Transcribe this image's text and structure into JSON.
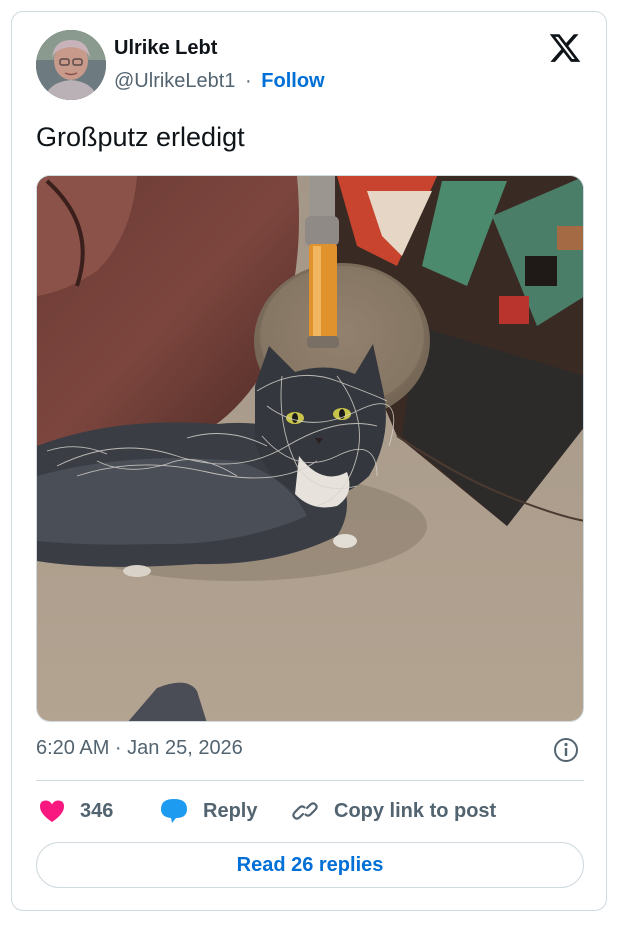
{
  "author": {
    "name": "Ulrike Lebt",
    "handle": "@UlrikeLebt1",
    "separator": "·",
    "follow_label": "Follow"
  },
  "brand": {
    "logo_icon": "x-logo-icon"
  },
  "post": {
    "text": "Großputz erledigt",
    "timestamp": "6:20 AM · Jan 25, 2026"
  },
  "actions": {
    "like_count": "346",
    "reply_label": "Reply",
    "copy_label": "Copy link to post",
    "read_replies_label": "Read 26 replies"
  },
  "colors": {
    "accent": "#006fd6",
    "like": "#f91880",
    "reply_bubble": "#1d9bf0",
    "muted_text": "#536471",
    "border": "#cfd9de"
  },
  "icons": [
    "x-logo-icon",
    "info-icon",
    "heart-icon",
    "reply-bubble-icon",
    "link-icon"
  ]
}
